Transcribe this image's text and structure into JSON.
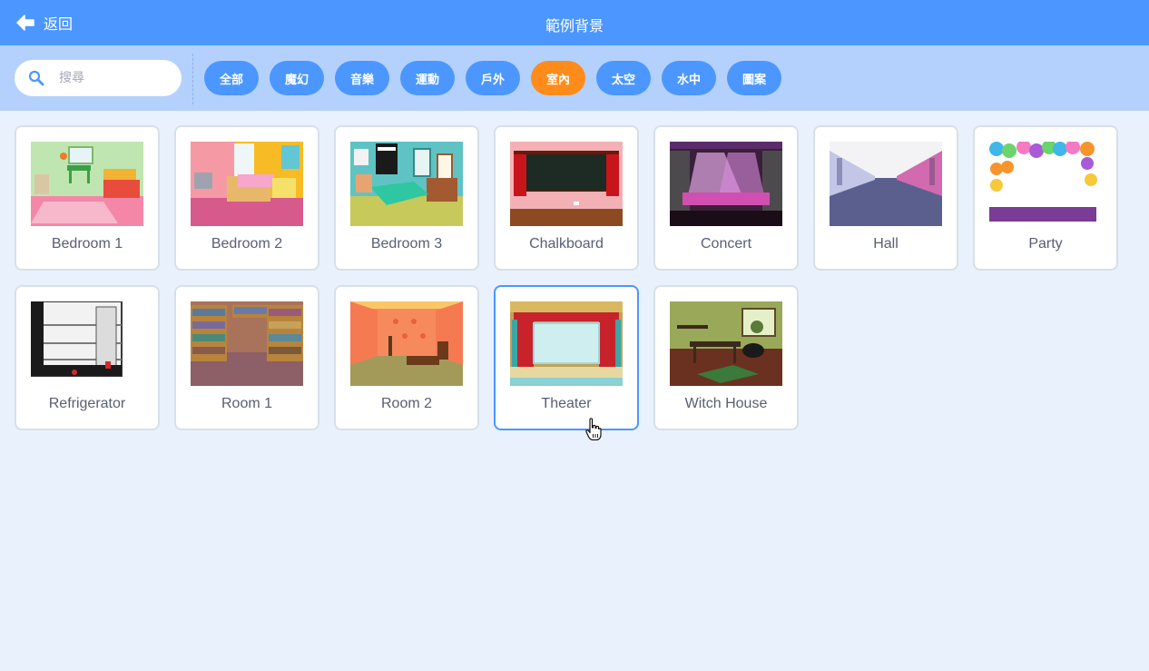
{
  "header": {
    "back_label": "返回",
    "title": "範例背景"
  },
  "search": {
    "placeholder": "搜尋",
    "value": ""
  },
  "tags": [
    {
      "label": "全部",
      "active": false
    },
    {
      "label": "魔幻",
      "active": false
    },
    {
      "label": "音樂",
      "active": false
    },
    {
      "label": "運動",
      "active": false
    },
    {
      "label": "戶外",
      "active": false
    },
    {
      "label": "室內",
      "active": true
    },
    {
      "label": "太空",
      "active": false
    },
    {
      "label": "水中",
      "active": false
    },
    {
      "label": "圖案",
      "active": false
    }
  ],
  "backdrops": [
    {
      "label": "Bedroom 1"
    },
    {
      "label": "Bedroom 2"
    },
    {
      "label": "Bedroom 3"
    },
    {
      "label": "Chalkboard"
    },
    {
      "label": "Concert"
    },
    {
      "label": "Hall"
    },
    {
      "label": "Party"
    },
    {
      "label": "Refrigerator"
    },
    {
      "label": "Room 1"
    },
    {
      "label": "Room 2"
    },
    {
      "label": "Theater",
      "hovered": true
    },
    {
      "label": "Witch House"
    }
  ],
  "colors": {
    "header": "#4c97ff",
    "filterbar": "#b3d1fc",
    "background": "#e9f1fc",
    "tag": "#4c97ff",
    "tag_active": "#ff8c1a",
    "text": "#575e75"
  }
}
